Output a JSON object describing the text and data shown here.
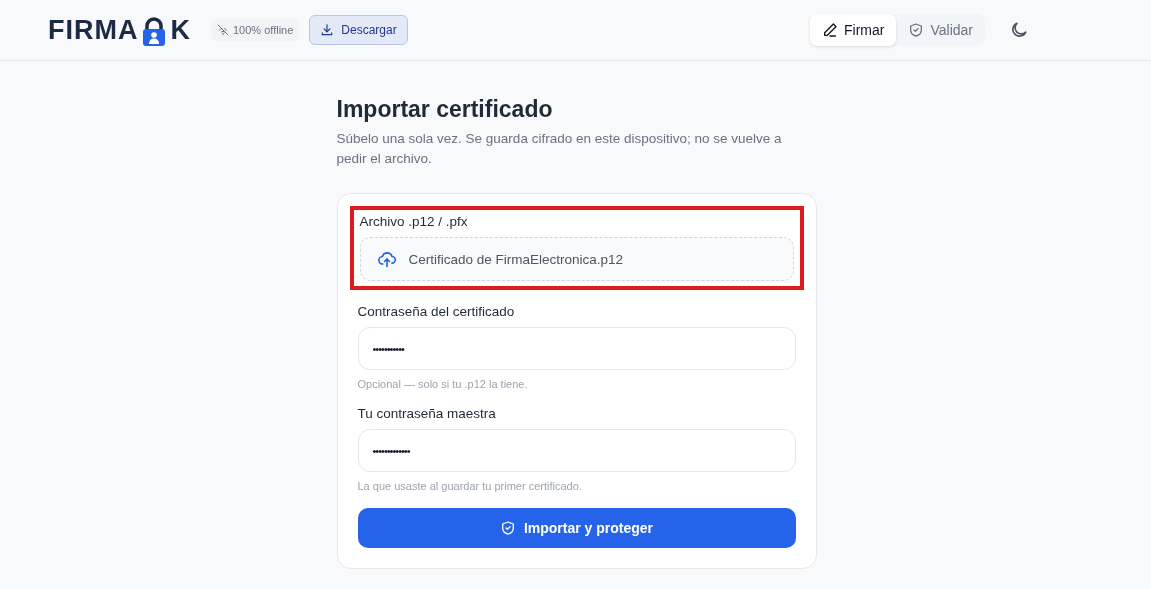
{
  "header": {
    "logo": {
      "before": "FIRMA",
      "after": "K"
    },
    "offline_badge": "100% offline",
    "download_button": "Descargar",
    "tabs": [
      {
        "label": "Firmar",
        "kind": "sign",
        "selected": true
      },
      {
        "label": "Validar",
        "kind": "validate",
        "selected": false
      }
    ]
  },
  "page": {
    "title": "Importar certificado",
    "subtitle": "Súbelo una sola vez. Se guarda cifrado en este dispositivo; no se vuelve a pedir el archivo.",
    "form": {
      "fields": [
        {
          "kind": "file",
          "label": "Archivo .p12 / .pfx",
          "value": "Certificado de FirmaElectronica.p12",
          "highlighted": true
        },
        {
          "kind": "password",
          "label": "Contraseña del certificado",
          "value": "•••••••••••",
          "hint": "Opcional — solo si tu .p12 la tiene."
        },
        {
          "kind": "password",
          "label": "Tu contraseña maestra",
          "value": "•••••••••••••",
          "hint": "La que usaste al guardar tu primer certificado."
        }
      ],
      "submit": "Importar y proteger"
    }
  }
}
